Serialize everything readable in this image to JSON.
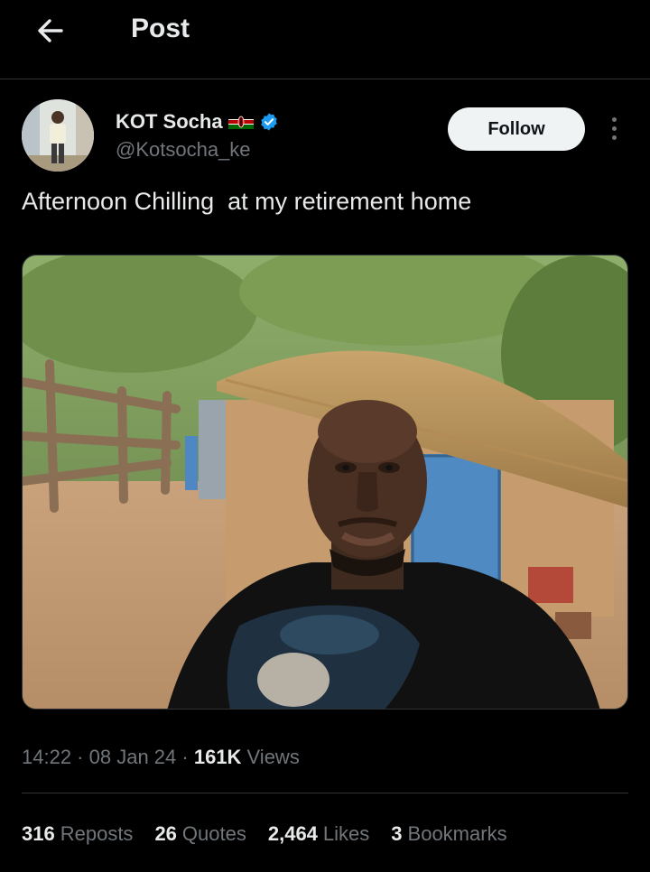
{
  "header": {
    "title": "Post",
    "back_icon": "arrow-left-icon"
  },
  "author": {
    "display_name": "KOT Socha",
    "flag_icon": "kenya-flag-icon",
    "verified_icon": "verified-badge-icon",
    "handle": "@Kotsocha_ke",
    "follow_label": "Follow",
    "more_icon": "more-vertical-icon"
  },
  "post": {
    "text": "Afternoon Chilling  at my retirement home",
    "image": "photo of a man taking a selfie in front of a thatched hut"
  },
  "meta": {
    "time": "14:22",
    "separator": " · ",
    "date": "08 Jan 24",
    "views_count": "161K",
    "views_label": " Views"
  },
  "stats": [
    {
      "count": "316",
      "label": "Reposts"
    },
    {
      "count": "26",
      "label": "Quotes"
    },
    {
      "count": "2,464",
      "label": "Likes"
    },
    {
      "count": "3",
      "label": "Bookmarks"
    }
  ],
  "colors": {
    "background": "#000000",
    "text_primary": "#e7e9ea",
    "text_secondary": "#71767b",
    "divider": "#2f3336",
    "verified": "#1d9bf0"
  }
}
